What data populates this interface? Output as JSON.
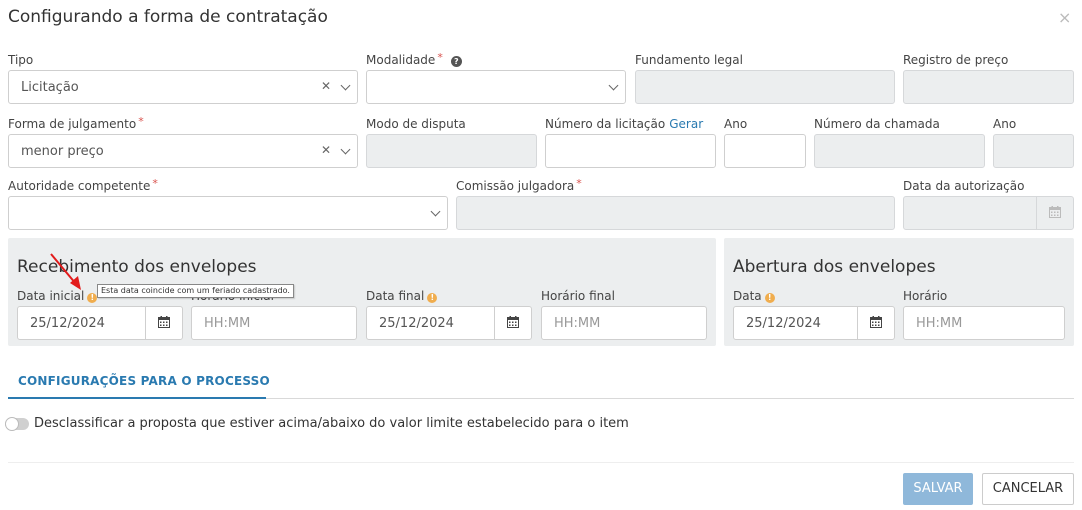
{
  "modal": {
    "title": "Configurando a forma de contratação",
    "close": "×"
  },
  "row1": {
    "tipo": {
      "label": "Tipo",
      "value": "Licitação"
    },
    "modalidade": {
      "label": "Modalidade",
      "required": "*",
      "value": ""
    },
    "fundamento": {
      "label": "Fundamento legal"
    },
    "registro": {
      "label": "Registro de preço"
    }
  },
  "row2": {
    "julgamento": {
      "label": "Forma de julgamento",
      "required": "*",
      "value": "menor preço"
    },
    "disputa": {
      "label": "Modo de disputa"
    },
    "numero_licitacao": {
      "label": "Número da licitação",
      "action": "Gerar"
    },
    "ano1": {
      "label": "Ano"
    },
    "numero_chamada": {
      "label": "Número da chamada"
    },
    "ano2": {
      "label": "Ano"
    }
  },
  "row3": {
    "autoridade": {
      "label": "Autoridade competente",
      "required": "*"
    },
    "comissao": {
      "label": "Comissão julgadora",
      "required": "*"
    },
    "data_autorizacao": {
      "label": "Data da autorização"
    }
  },
  "recebimento": {
    "title": "Recebimento dos envelopes",
    "data_inicial": {
      "label": "Data inicial",
      "value": "25/12/2024"
    },
    "horario_inicial": {
      "label": "Horário inicial",
      "placeholder": "HH:MM"
    },
    "data_final": {
      "label": "Data final",
      "value": "25/12/2024"
    },
    "horario_final": {
      "label": "Horário final",
      "placeholder": "HH:MM"
    },
    "tooltip": "Esta data coincide com um feriado cadastrado."
  },
  "abertura": {
    "title": "Abertura dos envelopes",
    "data": {
      "label": "Data",
      "value": "25/12/2024"
    },
    "horario": {
      "label": "Horário",
      "placeholder": "HH:MM"
    }
  },
  "tabs": {
    "processo": "CONFIGURAÇÕES PARA O PROCESSO"
  },
  "toggle": {
    "label": "Desclassificar a proposta que estiver acima/abaixo do valor limite estabelecido para o item",
    "on": false
  },
  "footer": {
    "save": "SALVAR",
    "cancel": "CANCELAR"
  },
  "icons": {
    "clear": "x-icon",
    "dropdown": "chevron-down-icon",
    "calendar": "calendar-icon",
    "warning": "warning-icon",
    "help": "question-icon",
    "close": "close-icon"
  },
  "colors": {
    "accent": "#2a7ab0",
    "required": "#d9534f",
    "warning": "#f0ad4e",
    "save_button": "#8fb8da",
    "disabled_field": "#eceeef"
  }
}
